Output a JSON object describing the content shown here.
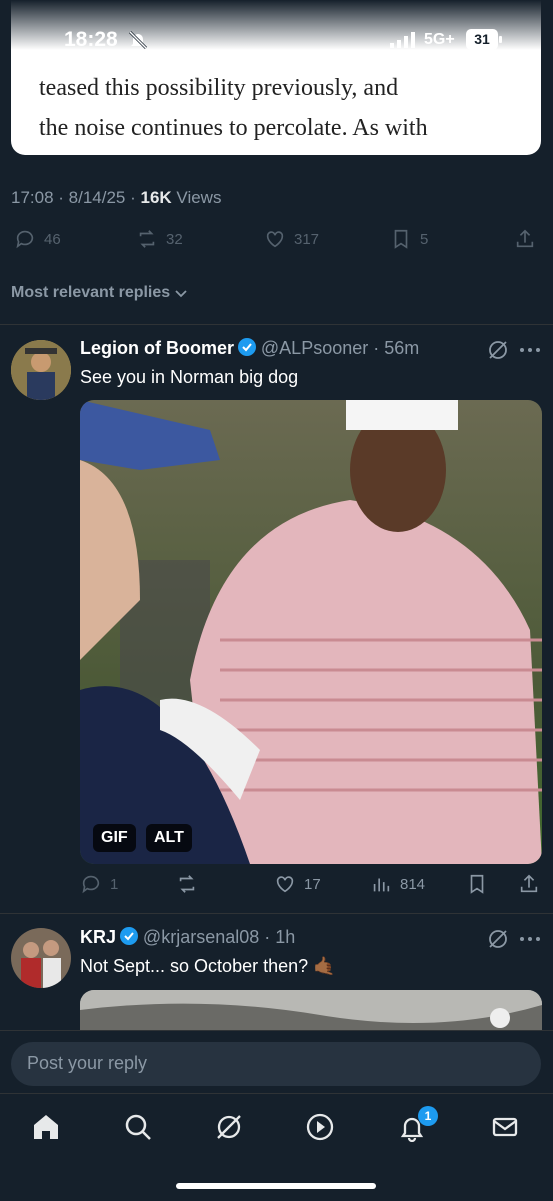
{
  "status": {
    "time": "18:28",
    "network": "5G+",
    "battery": "31"
  },
  "article": {
    "line1": "teased this possibility previously, and",
    "line2": "the noise continues to percolate. As with"
  },
  "post_meta": {
    "time": "17:08",
    "date": "8/14/25",
    "views_count": "16K",
    "views_label": "Views"
  },
  "post_actions": {
    "replies": "46",
    "reposts": "32",
    "likes": "317",
    "bookmarks": "5"
  },
  "replies_filter": "Most relevant replies",
  "replies": [
    {
      "name": "Legion of Boomer",
      "handle": "@ALPsooner",
      "age": "56m",
      "text": "See you in Norman big dog",
      "media_badges": [
        "GIF",
        "ALT"
      ],
      "actions": {
        "replies": "1",
        "likes": "17",
        "views": "814"
      }
    },
    {
      "name": "KRJ",
      "handle": "@krjarsenal08",
      "age": "1h",
      "text": "Not Sept... so October then? 🤙🏾"
    }
  ],
  "compose": {
    "placeholder": "Post your reply"
  },
  "tabs": {
    "notifications_badge": "1"
  },
  "colors": {
    "background": "#15202b",
    "accent": "#1d9bf0",
    "muted": "#8b98a5"
  },
  "icons": [
    "bell-off-icon",
    "signal-icon",
    "reply-icon",
    "repost-icon",
    "like-icon",
    "bookmark-icon",
    "share-icon",
    "grok-icon",
    "more-icon",
    "views-icon",
    "home-icon",
    "search-icon",
    "play-icon",
    "notifications-icon",
    "mail-icon"
  ]
}
